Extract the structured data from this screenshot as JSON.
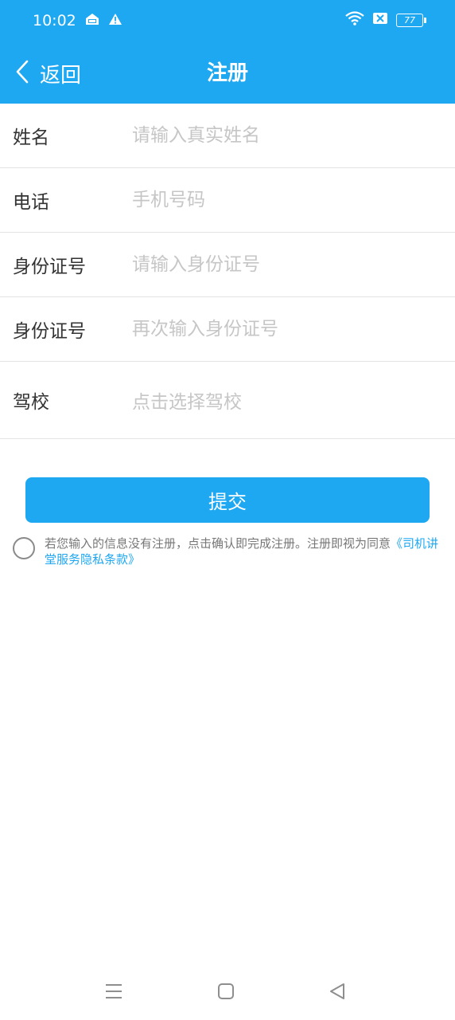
{
  "status": {
    "time": "10:02",
    "battery": "77"
  },
  "header": {
    "back_label": "返回",
    "title": "注册"
  },
  "form": {
    "rows": [
      {
        "label": "姓名",
        "placeholder": "请输入真实姓名"
      },
      {
        "label": "电话",
        "placeholder": "手机号码"
      },
      {
        "label": "身份证号",
        "placeholder": "请输入身份证号"
      },
      {
        "label": "身份证号",
        "placeholder": "再次输入身份证号"
      },
      {
        "label": "驾校",
        "placeholder": "点击选择驾校"
      }
    ]
  },
  "submit_label": "提交",
  "agreement": {
    "text": "若您输入的信息没有注册，点击确认即完成注册。注册即视为同意",
    "link": "《司机讲堂服务隐私条款》"
  },
  "colors": {
    "accent": "#1ea8f2",
    "placeholder": "#c6c6c6",
    "divider": "#e3e3e3"
  },
  "icons": {
    "back": "chevron-left-icon",
    "nav_menu": "menu-icon",
    "nav_home": "home-square-icon",
    "nav_back": "back-triangle-icon"
  }
}
